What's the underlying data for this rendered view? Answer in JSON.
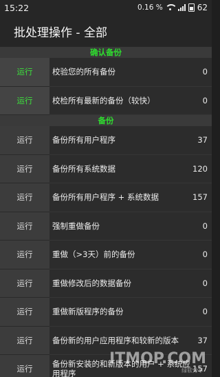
{
  "status": {
    "time": "15:22",
    "speed": "0.16 ",
    "speed_unit": "%",
    "battery": "62"
  },
  "title": "批处理操作 - 全部",
  "sections": [
    {
      "header": "确认备份",
      "rows": [
        {
          "run": "运行",
          "desc": "校验您的所有备份",
          "count": "0"
        },
        {
          "run": "运行",
          "desc": "校检所有最新的备份（较快）",
          "count": "0"
        }
      ]
    },
    {
      "header": "备份",
      "rows": [
        {
          "run": "运行",
          "desc": "备份所有用户程序",
          "count": "37"
        },
        {
          "run": "运行",
          "desc": "备份所有系统数据",
          "count": "120"
        },
        {
          "run": "运行",
          "desc": "备份所有用户程序 + 系统数据",
          "count": "157"
        },
        {
          "run": "运行",
          "desc": "强制重做备份",
          "count": "0"
        },
        {
          "run": "运行",
          "desc": "重做（>3天）前的备份",
          "count": "0"
        },
        {
          "run": "运行",
          "desc": "重做修改后的数据备份",
          "count": "0"
        },
        {
          "run": "运行",
          "desc": "重做新版程序的备份",
          "count": "0"
        },
        {
          "run": "运行",
          "desc": "备份新的用户应用程序和较新的版本",
          "count": "37"
        },
        {
          "run": "运行",
          "desc": "备份新安装的和新版本的用户 + 系统应用程序",
          "count": "157"
        }
      ]
    }
  ],
  "watermark": {
    "text": "ITMOP.COM",
    "sub": "绿软分享"
  }
}
